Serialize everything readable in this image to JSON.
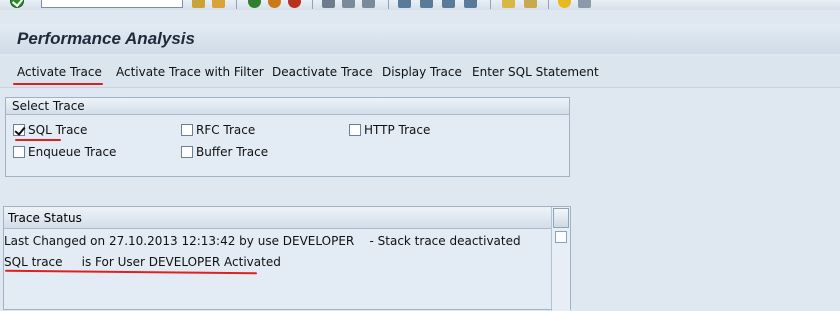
{
  "toolbar": {
    "command_field": "",
    "icons": [
      "enter-icon",
      "back-icon",
      "save-icon",
      "exit-icon",
      "cancel-icon",
      "print-icon",
      "find-icon",
      "find-next-icon",
      "first-page-icon",
      "previous-page-icon",
      "next-page-icon",
      "last-page-icon",
      "new-session-icon",
      "shortcut-icon",
      "help-icon",
      "layout-menu-icon"
    ]
  },
  "page": {
    "title": "Performance Analysis"
  },
  "app_toolbar": {
    "activate_trace": "Activate Trace",
    "activate_trace_filter": "Activate Trace with Filter",
    "deactivate_trace": "Deactivate Trace",
    "display_trace": "Display Trace",
    "enter_sql": "Enter SQL Statement"
  },
  "select_trace": {
    "header": "Select Trace",
    "options": [
      {
        "label": "SQL Trace",
        "checked": true
      },
      {
        "label": "RFC Trace",
        "checked": false
      },
      {
        "label": "HTTP Trace",
        "checked": false
      },
      {
        "label": "Enqueue Trace",
        "checked": false
      },
      {
        "label": "Buffer Trace",
        "checked": false
      }
    ]
  },
  "trace_status": {
    "header": "Trace Status",
    "line1": "Last Changed on 27.10.2013 12:13:42 by use DEVELOPER    - Stack trace deactivated",
    "line2": "SQL trace     is For User DEVELOPER Activated"
  },
  "colors": {
    "annotation_red": "#e02020",
    "background": "#dfe8f0"
  }
}
